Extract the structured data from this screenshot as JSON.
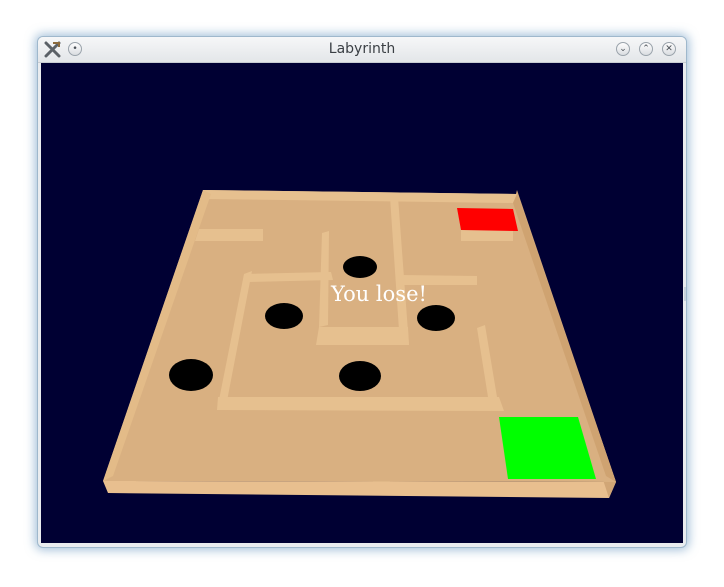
{
  "window": {
    "title": "Labyrinth",
    "buttons": {
      "menu_icon": "x-tools-icon",
      "sticky_icon": "circle-dot-icon",
      "minimize_glyph": "⌄",
      "maximize_glyph": "⌃",
      "close_glyph": "✕"
    }
  },
  "game": {
    "status_message": "You lose!",
    "background_color": "#000033",
    "board_color": "#d9b081",
    "wall_color": "#e6c08f",
    "hole_color": "#000000",
    "start_color": "#ff0000",
    "goal_color": "#00ff00",
    "hole_count": 5
  }
}
